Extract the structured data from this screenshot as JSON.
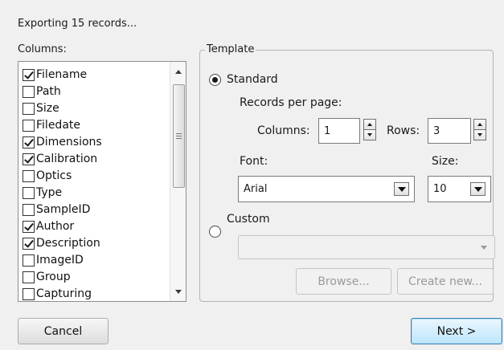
{
  "header": {
    "status_text": "Exporting 15 records..."
  },
  "columns": {
    "label": "Columns:",
    "items": [
      {
        "label": "Filename",
        "checked": true
      },
      {
        "label": "Path",
        "checked": false
      },
      {
        "label": "Size",
        "checked": false
      },
      {
        "label": "Filedate",
        "checked": false
      },
      {
        "label": "Dimensions",
        "checked": true
      },
      {
        "label": "Calibration",
        "checked": true
      },
      {
        "label": "Optics",
        "checked": false
      },
      {
        "label": "Type",
        "checked": false
      },
      {
        "label": "SampleID",
        "checked": false
      },
      {
        "label": "Author",
        "checked": true
      },
      {
        "label": "Description",
        "checked": true
      },
      {
        "label": "ImageID",
        "checked": false
      },
      {
        "label": "Group",
        "checked": false
      },
      {
        "label": "Capturing",
        "checked": false
      }
    ]
  },
  "template": {
    "legend": "Template",
    "standard_label": "Standard",
    "records_per_page_label": "Records per page:",
    "columns_label": "Columns:",
    "columns_value": "1",
    "rows_label": "Rows:",
    "rows_value": "3",
    "font_label": "Font:",
    "font_value": "Arial",
    "size_label": "Size:",
    "size_value": "10",
    "custom_label": "Custom",
    "custom_value": "",
    "browse_label": "Browse...",
    "create_new_label": "Create new..."
  },
  "footer": {
    "cancel_label": "Cancel",
    "next_label": "Next >"
  }
}
